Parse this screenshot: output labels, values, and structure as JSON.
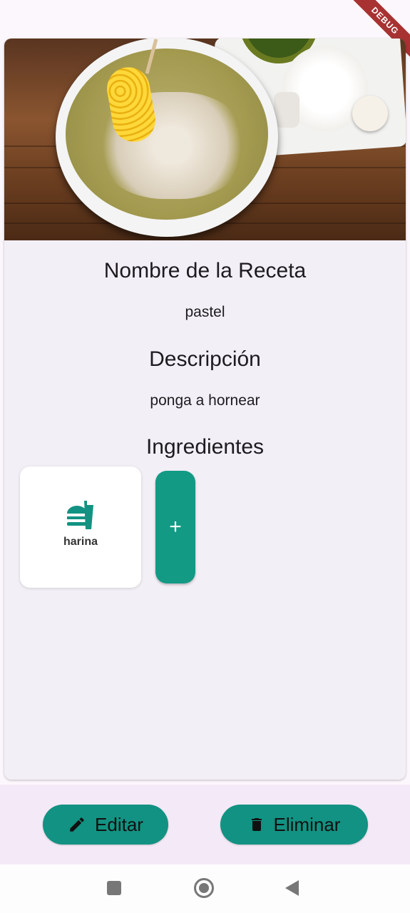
{
  "debug_banner": "DEBUG",
  "recipe": {
    "name_heading": "Nombre de la Receta",
    "name": "pastel",
    "description_heading": "Descripción",
    "description": "ponga a hornear",
    "ingredients_heading": "Ingredientes",
    "ingredients": [
      {
        "name": "harina",
        "icon": "fastfood-icon"
      }
    ],
    "add_ingredient_label": "+"
  },
  "actions": {
    "edit": "Editar",
    "delete": "Eliminar"
  },
  "colors": {
    "accent": "#129a85",
    "card": "#f3eff6"
  }
}
